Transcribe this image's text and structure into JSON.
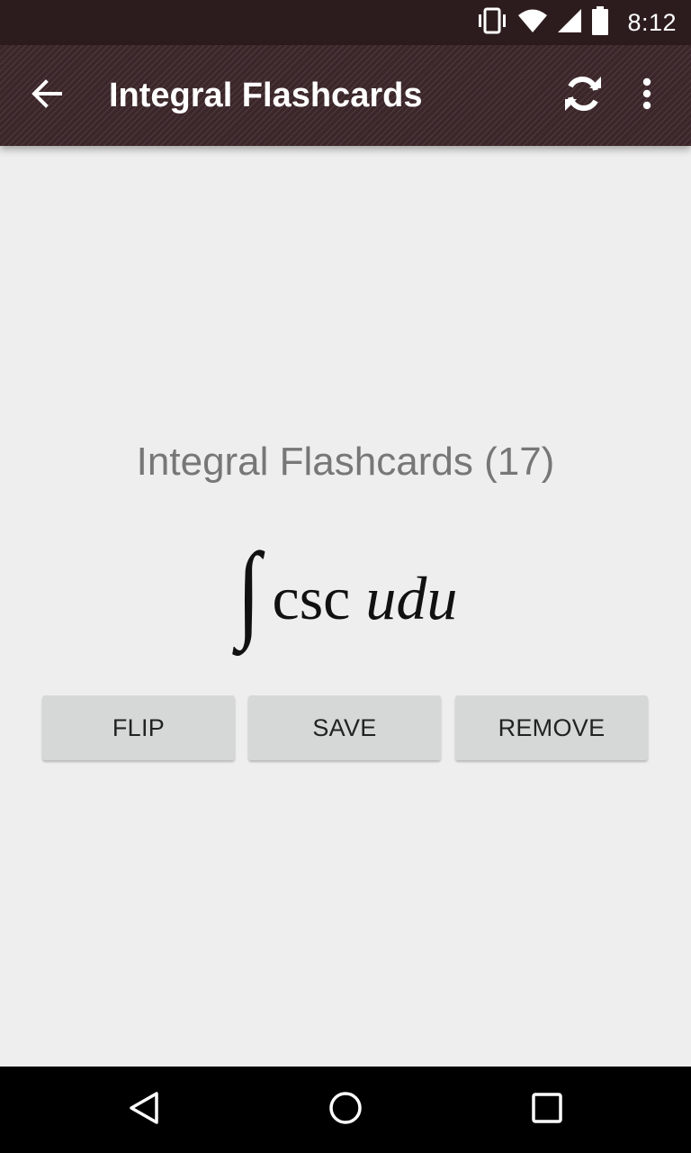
{
  "status_bar": {
    "time": "8:12",
    "icons": [
      "vibrate-icon",
      "wifi-icon",
      "signal-icon",
      "battery-icon"
    ]
  },
  "app_bar": {
    "title": "Integral Flashcards",
    "icons": [
      "arrow-back-icon",
      "sync-icon",
      "more-vert-icon"
    ]
  },
  "card": {
    "deck_title": "Integral Flashcards (17)",
    "formula": {
      "integral_symbol": "∫",
      "function_text": "csc",
      "variable_text": "udu"
    }
  },
  "actions": {
    "flip_label": "FLIP",
    "save_label": "SAVE",
    "remove_label": "REMOVE"
  },
  "nav_bar": {
    "icons": [
      "nav-back-icon",
      "nav-home-icon",
      "nav-recents-icon"
    ]
  },
  "colors": {
    "status_bar": "#2d1c1e",
    "app_bar": "#3b2629",
    "background": "#eeeeee",
    "button": "#d6d7d7",
    "deck_title_text": "#777777"
  }
}
